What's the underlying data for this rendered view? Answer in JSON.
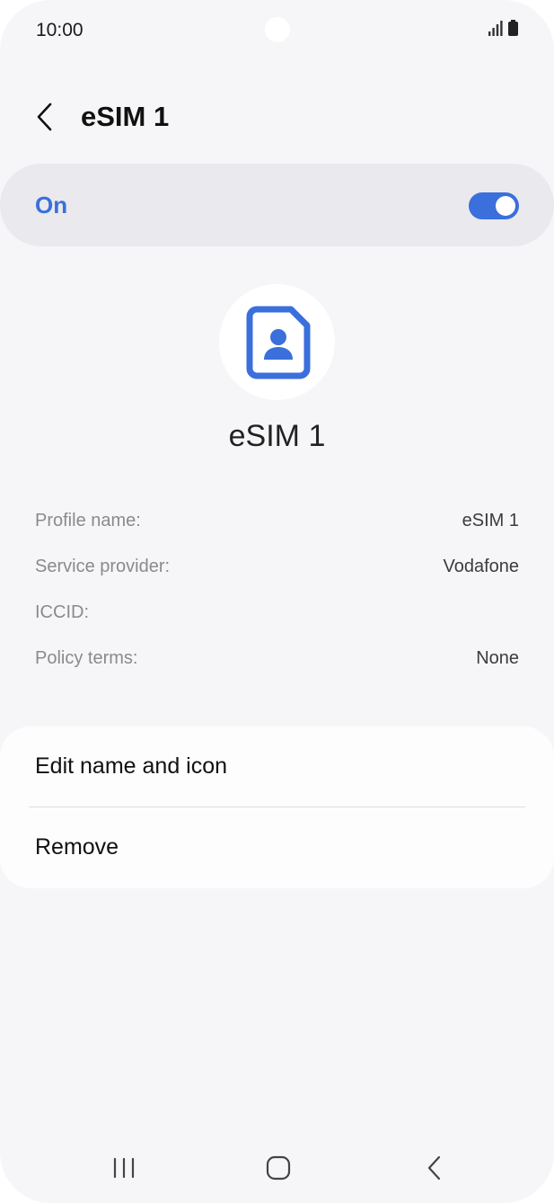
{
  "status_bar": {
    "time": "10:00",
    "icons": [
      "signal-icon",
      "battery-icon"
    ]
  },
  "header": {
    "title": "eSIM 1",
    "back_icon": "chevron-left-icon"
  },
  "toggle": {
    "label": "On",
    "state": "on"
  },
  "profile": {
    "icon": "sim-card-user-icon",
    "name": "eSIM 1"
  },
  "info": {
    "rows": [
      {
        "label": "Profile name:",
        "value": "eSIM 1"
      },
      {
        "label": "Service provider:",
        "value": "Vodafone"
      },
      {
        "label": "ICCID:",
        "value": ""
      },
      {
        "label": "Policy terms:",
        "value": "None"
      }
    ]
  },
  "actions": {
    "items": [
      {
        "label": "Edit name and icon"
      },
      {
        "label": "Remove"
      }
    ]
  },
  "nav_bar": {
    "items": [
      "recent-apps-icon",
      "home-icon",
      "back-icon"
    ]
  },
  "colors": {
    "accent": "#3a6fdc",
    "background": "#f6f6f8",
    "card": "#e9e9ee"
  }
}
